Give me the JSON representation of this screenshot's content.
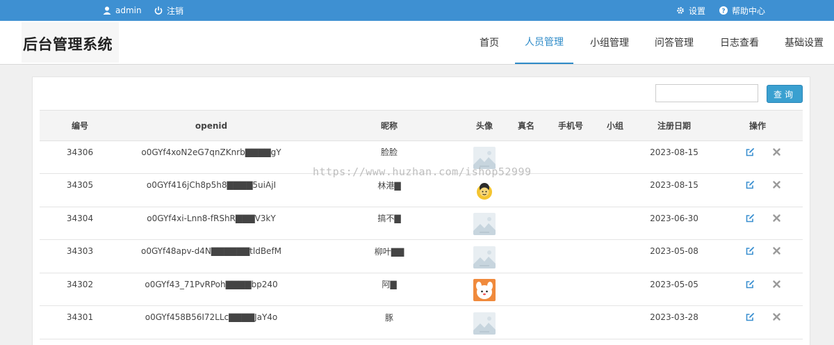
{
  "topbar": {
    "user": "admin",
    "logout": "注销",
    "settings": "设置",
    "help": "帮助中心"
  },
  "header": {
    "logo": "后台管理系统",
    "nav": [
      "首页",
      "人员管理",
      "小组管理",
      "问答管理",
      "日志查看",
      "基础设置"
    ],
    "active_index": 1
  },
  "search": {
    "value": "",
    "button": "查询"
  },
  "table": {
    "columns": [
      "编号",
      "openid",
      "昵称",
      "头像",
      "真名",
      "手机号",
      "小组",
      "注册日期",
      "操作"
    ],
    "rows": [
      {
        "id": "34306",
        "openid": "o0GYf4xoN2eG7qnZKnrb▇▇▇▇gY",
        "nickname": "脸脸",
        "avatar": "placeholder-image",
        "realname": "",
        "phone": "",
        "group": "",
        "date": "2023-08-15"
      },
      {
        "id": "34305",
        "openid": "o0GYf416jCh8p5h8▇▇▇▇5uiAjI",
        "nickname": "林港▇",
        "avatar": "cartoon-avatar-yellow",
        "realname": "",
        "phone": "",
        "group": "",
        "date": "2023-08-15"
      },
      {
        "id": "34304",
        "openid": "o0GYf4xi-Lnn8-fRShR▇▇▇V3kY",
        "nickname": "搞不▇",
        "avatar": "placeholder-image",
        "realname": "",
        "phone": "",
        "group": "",
        "date": "2023-06-30"
      },
      {
        "id": "34303",
        "openid": "o0GYf48apv-d4N▇▇▇▇▇▇tldBefM",
        "nickname": "柳叶▇▇",
        "avatar": "placeholder-image",
        "realname": "",
        "phone": "",
        "group": "",
        "date": "2023-05-08"
      },
      {
        "id": "34302",
        "openid": "o0GYf43_71PvRPoh▇▇▇▇bp240",
        "nickname": "阿▇",
        "avatar": "cartoon-avatar-orange",
        "realname": "",
        "phone": "",
        "group": "",
        "date": "2023-05-05"
      },
      {
        "id": "34301",
        "openid": "o0GYf458B56I72LLc▇▇▇▇JaY4o",
        "nickname": "豚",
        "avatar": "placeholder-image",
        "realname": "",
        "phone": "",
        "group": "",
        "date": "2023-03-28"
      }
    ],
    "action_icons": [
      "edit-icon",
      "delete-icon"
    ]
  },
  "watermark": "https://www.huzhan.com/ishop52999",
  "colors": {
    "topbar": "#3e90d2",
    "accent": "#2e8bc8",
    "button": "#3aa0d0"
  }
}
